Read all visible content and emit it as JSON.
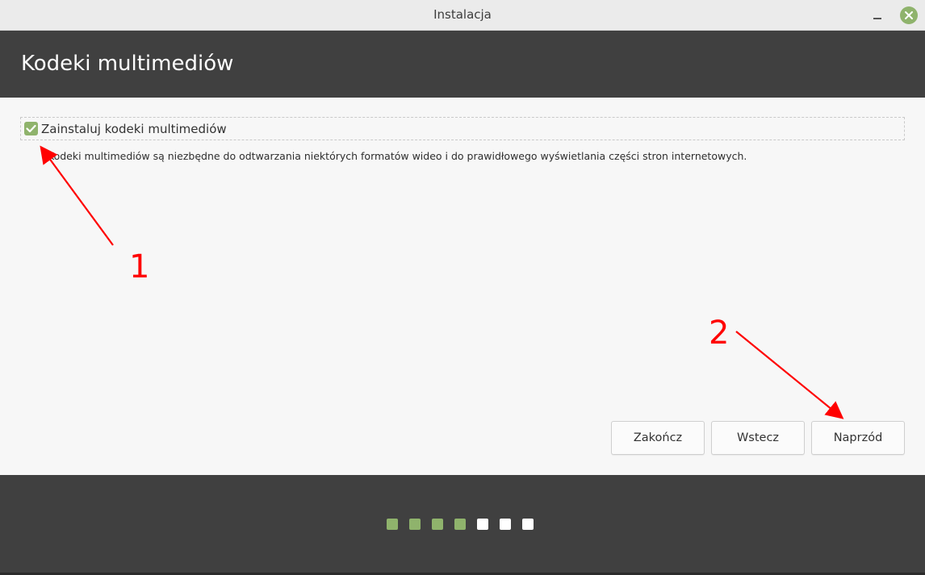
{
  "window": {
    "title": "Instalacja"
  },
  "header": {
    "title": "Kodeki multimediów"
  },
  "codecs": {
    "checkbox_label": "Zainstaluj kodeki multimediów",
    "checked": true,
    "description": "Kodeki multimediów są niezbędne do odtwarzania niektórych formatów wideo i do prawidłowego wyświetlania części stron internetowych."
  },
  "buttons": {
    "quit": "Zakończ",
    "back": "Wstecz",
    "next": "Naprzód"
  },
  "progress": {
    "total_steps": 7,
    "completed_steps": 4
  },
  "annotations": {
    "label_1": "1",
    "label_2": "2"
  },
  "colors": {
    "accent": "#8fb36c",
    "header_bg": "#404040",
    "annotation": "#ff0000"
  },
  "icons": {
    "checkbox": "checkmark-icon",
    "close": "close-icon",
    "minimize": "minimize-icon"
  }
}
